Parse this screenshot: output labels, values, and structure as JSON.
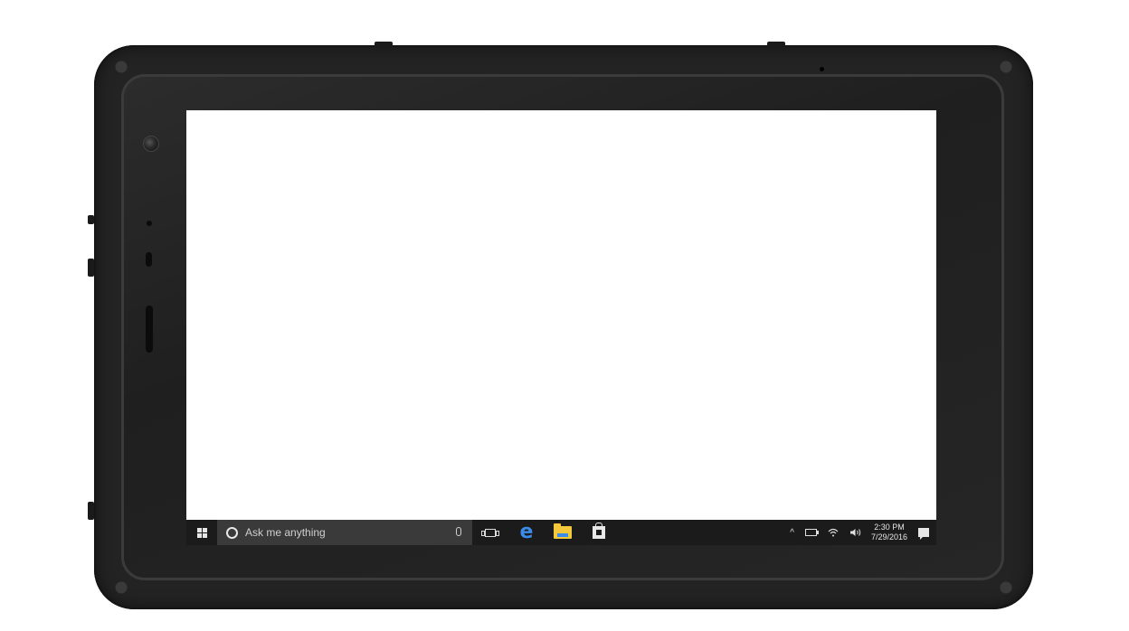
{
  "taskbar": {
    "start_icon": "windows-logo-icon",
    "search": {
      "placeholder": "Ask me anything",
      "cortana_icon": "cortana-circle-icon",
      "mic_icon": "microphone-icon"
    },
    "pinned_apps": [
      {
        "name": "task-view-icon"
      },
      {
        "name": "edge-icon"
      },
      {
        "name": "file-explorer-icon"
      },
      {
        "name": "store-icon"
      }
    ],
    "tray": {
      "chevron": "^",
      "icons": [
        "battery-icon",
        "wifi-icon",
        "volume-icon"
      ],
      "time": "2:30 PM",
      "date": "7/29/2016",
      "notification_icon": "action-center-icon"
    }
  },
  "colors": {
    "taskbar_bg": "#1b1b1b",
    "search_bg": "#3a3a3a",
    "edge_blue": "#3b8ce8",
    "folder_yellow": "#f3c83a",
    "device_body": "#232323"
  }
}
